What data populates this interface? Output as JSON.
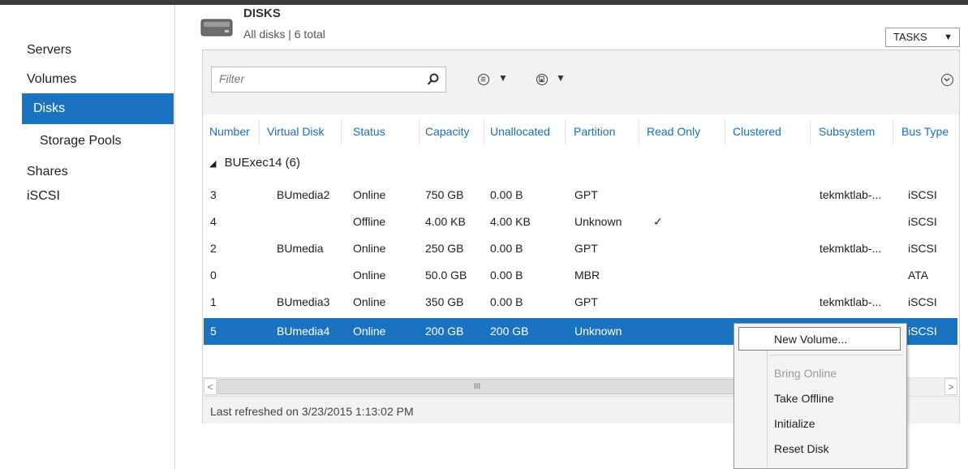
{
  "nav": {
    "items": [
      {
        "label": "Servers"
      },
      {
        "label": "Volumes"
      },
      {
        "label": "Disks"
      },
      {
        "label": "Storage Pools"
      },
      {
        "label": "Shares"
      },
      {
        "label": "iSCSI"
      }
    ],
    "selected": "Disks"
  },
  "header": {
    "title": "DISKS",
    "subtitle": "All disks | 6 total",
    "tasks_label": "TASKS",
    "tasks_arrow": "▼"
  },
  "toolbar": {
    "filter_placeholder": "Filter",
    "search_icon": "search-icon",
    "list_icon": "list-options-icon",
    "save_icon": "save-icon",
    "expand_icon": "chevron-down-icon",
    "dropdown_arrow": "▼"
  },
  "table": {
    "columns": [
      "Number",
      "Virtual Disk",
      "Status",
      "Capacity",
      "Unallocated",
      "Partition",
      "Read Only",
      "Clustered",
      "Subsystem",
      "Bus Type"
    ],
    "group": {
      "label": "BUExec14 (6)",
      "expander": "◢"
    },
    "rows": [
      {
        "number": "3",
        "virtual_disk": "BUmedia2",
        "status": "Online",
        "capacity": "750 GB",
        "unallocated": "0.00 B",
        "partition": "GPT",
        "read_only": "",
        "clustered": "",
        "subsystem": "tekmktlab-...",
        "bus_type": "iSCSI"
      },
      {
        "number": "4",
        "virtual_disk": "",
        "status": "Offline",
        "capacity": "4.00 KB",
        "unallocated": "4.00 KB",
        "partition": "Unknown",
        "read_only": "✓",
        "clustered": "",
        "subsystem": "",
        "bus_type": "iSCSI"
      },
      {
        "number": "2",
        "virtual_disk": "BUmedia",
        "status": "Online",
        "capacity": "250 GB",
        "unallocated": "0.00 B",
        "partition": "GPT",
        "read_only": "",
        "clustered": "",
        "subsystem": "tekmktlab-...",
        "bus_type": "iSCSI"
      },
      {
        "number": "0",
        "virtual_disk": "",
        "status": "Online",
        "capacity": "50.0 GB",
        "unallocated": "0.00 B",
        "partition": "MBR",
        "read_only": "",
        "clustered": "",
        "subsystem": "",
        "bus_type": "ATA"
      },
      {
        "number": "1",
        "virtual_disk": "BUmedia3",
        "status": "Online",
        "capacity": "350 GB",
        "unallocated": "0.00 B",
        "partition": "GPT",
        "read_only": "",
        "clustered": "",
        "subsystem": "tekmktlab-...",
        "bus_type": "iSCSI"
      },
      {
        "number": "5",
        "virtual_disk": "BUmedia4",
        "status": "Online",
        "capacity": "200 GB",
        "unallocated": "200 GB",
        "partition": "Unknown",
        "read_only": "",
        "clustered": "",
        "subsystem": "",
        "bus_type": "iSCSI"
      }
    ],
    "selected_row": 5
  },
  "scrollbar": {
    "left": "<",
    "right": ">",
    "grip": "III"
  },
  "status": {
    "last_refreshed": "Last refreshed on 3/23/2015 1:13:02 PM"
  },
  "context_menu": {
    "items": [
      {
        "label": "New Volume...",
        "enabled": true,
        "highlighted": true
      },
      {
        "label": "Bring Online",
        "enabled": false
      },
      {
        "label": "Take Offline",
        "enabled": true
      },
      {
        "label": "Initialize",
        "enabled": true
      },
      {
        "label": "Reset Disk",
        "enabled": true
      }
    ]
  },
  "colors": {
    "accent": "#1a73c0",
    "header_text": "#1a6fb5"
  }
}
